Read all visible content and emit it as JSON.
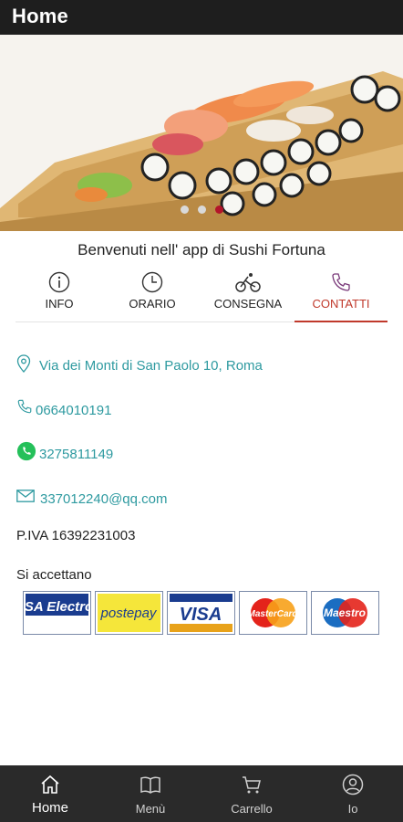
{
  "header": {
    "title": "Home"
  },
  "hero": {
    "slide_count": 3,
    "active_slide": 3
  },
  "welcome": "Benvenuti nell' app di Sushi Fortuna",
  "tabs": [
    {
      "label": "INFO",
      "icon": "info-icon"
    },
    {
      "label": "ORARIO",
      "icon": "clock-icon"
    },
    {
      "label": "CONSEGNA",
      "icon": "bicycle-icon"
    },
    {
      "label": "CONTATTI",
      "icon": "phone-icon",
      "active": true
    }
  ],
  "contacts": {
    "address": "Via dei Monti di San Paolo 10, Roma",
    "phone": "0664010191",
    "whatsapp": "3275811149",
    "email": "337012240@qq.com"
  },
  "piva": "P.IVA 16392231003",
  "payments": {
    "title": "Si accettano",
    "cards": [
      "VISA Electron",
      "postepay",
      "VISA",
      "MasterCard",
      "Maestro"
    ]
  },
  "bottom_nav": [
    {
      "label": "Home",
      "icon": "home-icon",
      "active": true
    },
    {
      "label": "Menù",
      "icon": "book-icon"
    },
    {
      "label": "Carrello",
      "icon": "cart-icon"
    },
    {
      "label": "Io",
      "icon": "user-icon"
    }
  ],
  "colors": {
    "topbar": "#1e1e1e",
    "accent": "#c0392b",
    "contact_text": "#2e9aa0",
    "bottom_nav": "#2a2a2a"
  }
}
